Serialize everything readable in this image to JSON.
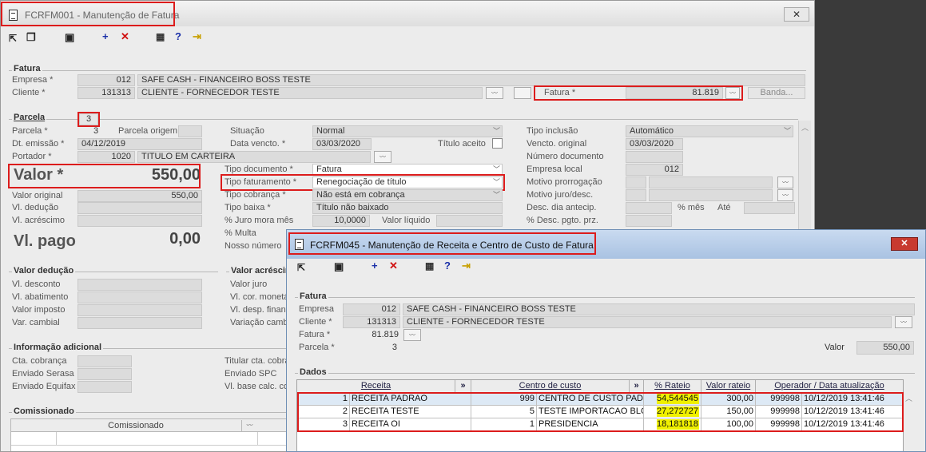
{
  "win1": {
    "title": "FCRFM001 - Manutenção de Fatura",
    "close": "✕",
    "fatura": {
      "label": "Fatura",
      "empresa_l": "Empresa *",
      "empresa_c": "012",
      "empresa_n": "SAFE CASH - FINANCEIRO BOSS TESTE",
      "cliente_l": "Cliente *",
      "cliente_c": "131313",
      "cliente_n": "CLIENTE - FORNECEDOR TESTE",
      "fatura_l": "Fatura *",
      "fatura_v": "81.819",
      "banda": "Banda..."
    },
    "parcela": {
      "label": "Parcela",
      "num": "3",
      "parcela_l": "Parcela *",
      "parcela_v": "3",
      "origem_l": "Parcela origem",
      "emissao_l": "Dt. emissão *",
      "emissao_v": "04/12/2019",
      "portador_l": "Portador *",
      "portador_c": "1020",
      "portador_n": "TITULO EM CARTEIRA",
      "valor_l": "Valor *",
      "valor_v": "550,00",
      "vorig_l": "Valor original",
      "vorig_v": "550,00",
      "vded_l": "Vl. dedução",
      "vacr_l": "Vl. acréscimo",
      "vpago_l": "Vl. pago",
      "vpago_v": "0,00",
      "situacao_l": "Situação",
      "situacao_v": "Normal",
      "venc_l": "Data vencto. *",
      "venc_v": "03/03/2020",
      "titulo_aceito_l": "Título aceito",
      "tipodoc_l": "Tipo documento *",
      "tipodoc_v": "Fatura",
      "tipofat_l": "Tipo faturamento *",
      "tipofat_v": "Renegociação de título",
      "tipocob_l": "Tipo cobrança *",
      "tipocob_v": "Não está em cobrança",
      "tipobaixa_l": "Tipo baixa *",
      "tipobaixa_v": "Título não baixado",
      "juro_l": "% Juro mora mês",
      "juro_v": "10,0000",
      "vliq_l": "Valor líquido",
      "multa_l": "% Multa",
      "nosso_l": "Nosso número",
      "tipoinc_l": "Tipo inclusão",
      "tipoinc_v": "Automático",
      "vorigv_l": "Vencto. original",
      "vorigv_v": "03/03/2020",
      "numdoc_l": "Número documento",
      "emploc_l": "Empresa local",
      "emploc_v": "012",
      "motprorr_l": "Motivo prorrogação",
      "motjuro_l": "Motivo juro/desc.",
      "desc_l": "Desc. dia antecip.",
      "mes_l": "% mês",
      "ate_l": "Até",
      "descpg_l": "% Desc. pgto. prz."
    },
    "valded": {
      "label": "Valor dedução",
      "items": [
        "Vl. desconto",
        "Vl. abatimento",
        "Valor imposto",
        "Var. cambial"
      ]
    },
    "valacr": {
      "label": "Valor acréscimo",
      "items": [
        "Valor juro",
        "Vl. cor. monetária",
        "Vl. desp. financeira",
        "Variação cambial"
      ]
    },
    "info": {
      "label": "Informação adicional",
      "items": [
        "Cta. cobrança",
        "Enviado Serasa",
        "Enviado Equifax"
      ],
      "items2": [
        "Titular cta. cobrança",
        "Enviado SPC",
        "Vl. base calc. comissão"
      ]
    },
    "comiss": {
      "label": "Comissionado",
      "col": "Comissionado"
    }
  },
  "win2": {
    "title": "FCRFM045 - Manutenção de Receita e Centro de Custo de Fatura",
    "close": "✕",
    "fatura": {
      "label": "Fatura",
      "empresa_l": "Empresa",
      "empresa_c": "012",
      "empresa_n": "SAFE CASH - FINANCEIRO BOSS TESTE",
      "cliente_l": "Cliente *",
      "cliente_c": "131313",
      "cliente_n": "CLIENTE - FORNECEDOR TESTE",
      "fatura_l": "Fatura *",
      "fatura_v": "81.819",
      "parcela_l": "Parcela *",
      "parcela_v": "3",
      "valor_l": "Valor",
      "valor_v": "550,00"
    },
    "dados": {
      "label": "Dados",
      "headers": [
        "Receita",
        "»",
        "Centro de custo",
        "»",
        "% Rateio",
        "Valor rateio",
        "Operador / Data atualização"
      ],
      "rows": [
        {
          "rc": "1",
          "rn": "RECEITA PADRAO",
          "cc": "999",
          "cn": "CENTRO DE CUSTO PADRAO",
          "pct": "54,544545",
          "val": "300,00",
          "op": "999998",
          "dt": "10/12/2019 13:41:46"
        },
        {
          "rc": "2",
          "rn": "RECEITA TESTE",
          "cc": "5",
          "cn": "TESTE IMPORTACAO BLOQ",
          "pct": "27,272727",
          "val": "150,00",
          "op": "999998",
          "dt": "10/12/2019 13:41:46"
        },
        {
          "rc": "3",
          "rn": "RECEITA OI",
          "cc": "1",
          "cn": "PRESIDENCIA",
          "pct": "18,181818",
          "val": "100,00",
          "op": "999998",
          "dt": "10/12/2019 13:41:46"
        }
      ]
    }
  },
  "colors": {
    "highlight": "#dc1c1c",
    "rateio_bg": "#f0f000"
  }
}
